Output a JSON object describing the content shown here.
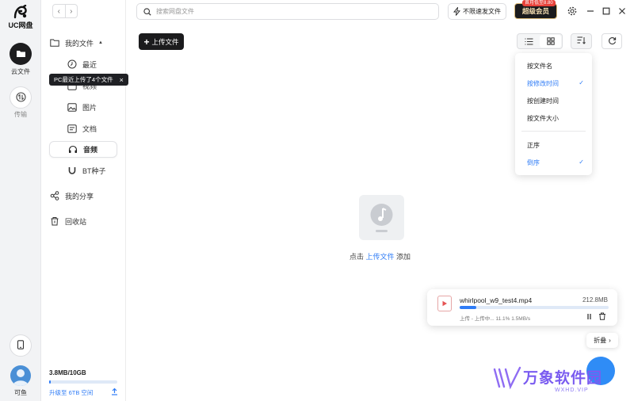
{
  "app": {
    "logo_text": "UC网盘"
  },
  "rail": {
    "items": [
      {
        "label": "云文件",
        "icon": "folder-icon",
        "active": true
      },
      {
        "label": "传输",
        "icon": "transfer-icon",
        "active": false
      }
    ],
    "user_name": "可鱼",
    "device_icon": "phone-icon"
  },
  "sidebar": {
    "my_files": "我的文件",
    "sub_items": [
      {
        "label": "最近",
        "icon": "clock-icon"
      },
      {
        "label": "视频",
        "icon": "video-icon"
      },
      {
        "label": "图片",
        "icon": "image-icon"
      },
      {
        "label": "文档",
        "icon": "document-icon"
      },
      {
        "label": "音频",
        "icon": "headphones-icon"
      },
      {
        "label": "BT种子",
        "icon": "magnet-icon"
      }
    ],
    "my_share": "我的分享",
    "recycle": "回收站",
    "tooltip": "PC最近上传了4个文件",
    "tooltip_close": "×",
    "storage": "3.8MB/10GB",
    "storage_used_percent": 0.04,
    "upgrade": "升级至 6TB 空间"
  },
  "topbar": {
    "search_placeholder": "搜索网盘文件",
    "fast_label": "不限速发文件",
    "vip_label": "超级会员",
    "vip_badge": "首月低至8.80"
  },
  "toolbar": {
    "upload_label": "上传文件",
    "upload_plus": "+"
  },
  "sort_menu": {
    "fields": [
      {
        "label": "按文件名",
        "checked": false
      },
      {
        "label": "按修改时间",
        "checked": true
      },
      {
        "label": "按创建时间",
        "checked": false
      },
      {
        "label": "按文件大小",
        "checked": false
      }
    ],
    "orders": [
      {
        "label": "正序",
        "checked": false
      },
      {
        "label": "倒序",
        "checked": true
      }
    ],
    "check_mark": "✓"
  },
  "empty_state": {
    "prefix": "点击 ",
    "link": "上传文件",
    "suffix": " 添加"
  },
  "upload_task": {
    "file_name": "whirlpool_w9_test4.mp4",
    "file_size": "212.8MB",
    "status": "上传 - 上传中... 11.1% 1.5MB/s",
    "progress_percent": 11.1
  },
  "collapse_label": "折叠",
  "watermark": {
    "title": "万象软件园",
    "sub": "WXHD.VIP"
  },
  "colors": {
    "accent": "#2f7cf6",
    "dark": "#1b1b1d",
    "vip_gold": "#f6dfb3",
    "badge_red": "#e8423a"
  }
}
